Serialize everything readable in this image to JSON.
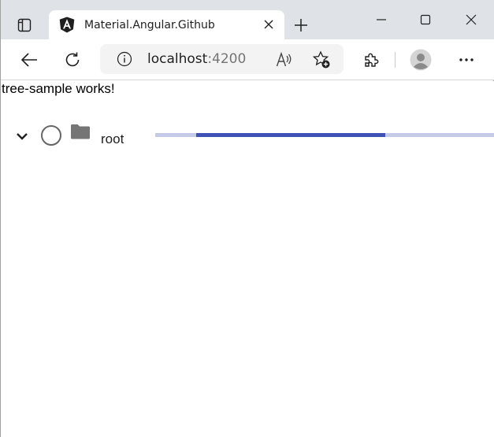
{
  "browser": {
    "tab": {
      "title": "Material.Angular.Github",
      "favicon": "angular-logo-icon"
    },
    "address": {
      "host": "localhost",
      "port": ":4200"
    },
    "icons": {
      "tab_actions": "tab-actions-icon",
      "close_tab": "close-icon",
      "new_tab": "plus-icon",
      "minimize": "minimize-icon",
      "maximize": "maximize-icon",
      "close_window": "close-icon",
      "back": "back-arrow-icon",
      "refresh": "refresh-icon",
      "site_info": "info-icon",
      "read_aloud": "read-aloud-icon",
      "favorites": "add-favorite-icon",
      "extensions": "puzzle-icon",
      "profile": "avatar-icon",
      "menu": "more-icon"
    }
  },
  "page": {
    "heading": "tree-sample works!",
    "tree": {
      "nodes": [
        {
          "label": "root",
          "expanded": true,
          "selected": false,
          "icon": "folder-icon",
          "progress": {
            "indeterminate": true,
            "fill_start": 0.12,
            "fill_end": 0.68
          }
        }
      ]
    }
  },
  "colors": {
    "tabstrip": "#dfe3e8",
    "progress_track": "#c5cae9",
    "progress_fill": "#3f51b5",
    "folder": "#757575"
  }
}
